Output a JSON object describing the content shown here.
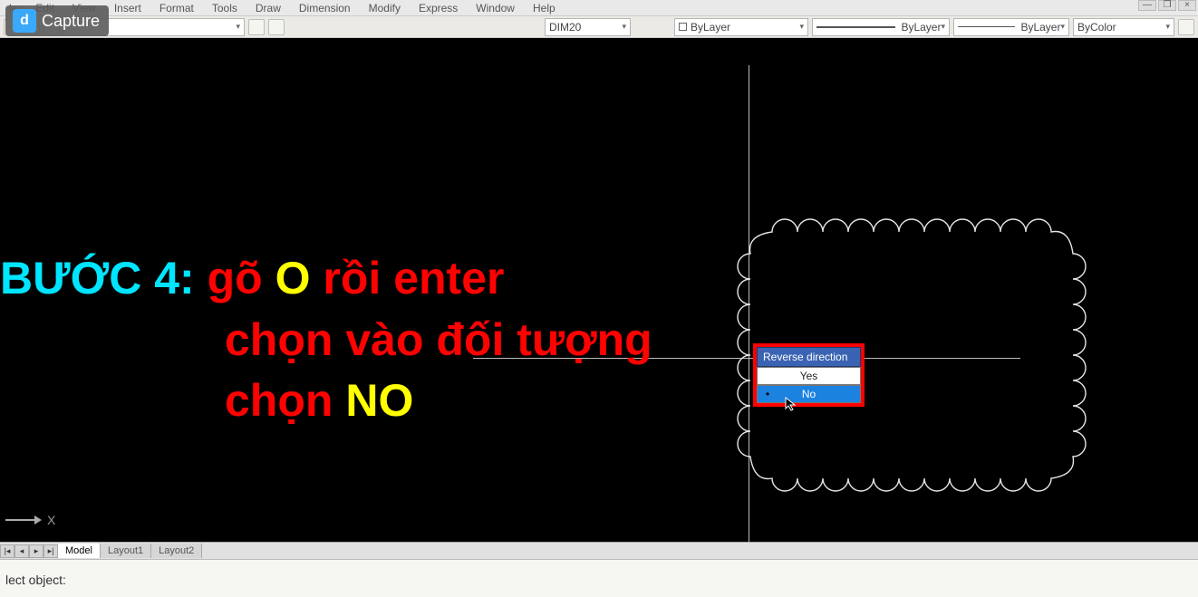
{
  "app_badge": {
    "icon_letter": "d",
    "label": "Capture"
  },
  "menubar": [
    "le",
    "Edit",
    "View",
    "Insert",
    "Format",
    "Tools",
    "Draw",
    "Dimension",
    "Modify",
    "Express",
    "Window",
    "Help"
  ],
  "window_buttons": [
    "—",
    "❐",
    "×"
  ],
  "toolbar": {
    "dim_combo": "DIM20",
    "layer_combo": "ByLayer",
    "linetype_combo": "ByLayer",
    "lineweight_combo": "ByLayer",
    "color_combo": "ByColor"
  },
  "instruction": {
    "step_label": "BƯỚC 4:",
    "line1_a": "gõ",
    "line1_b": "O",
    "line1_c": "rồi enter",
    "line2": "chọn vào đối tượng",
    "line3_a": "chọn",
    "line3_b": "NO"
  },
  "popup": {
    "title": "Reverse direction",
    "opt_yes": "Yes",
    "opt_no": "No"
  },
  "ucs_label": "X",
  "layout_tabs": {
    "model": "Model",
    "l1": "Layout1",
    "l2": "Layout2"
  },
  "command_line": "lect object:"
}
